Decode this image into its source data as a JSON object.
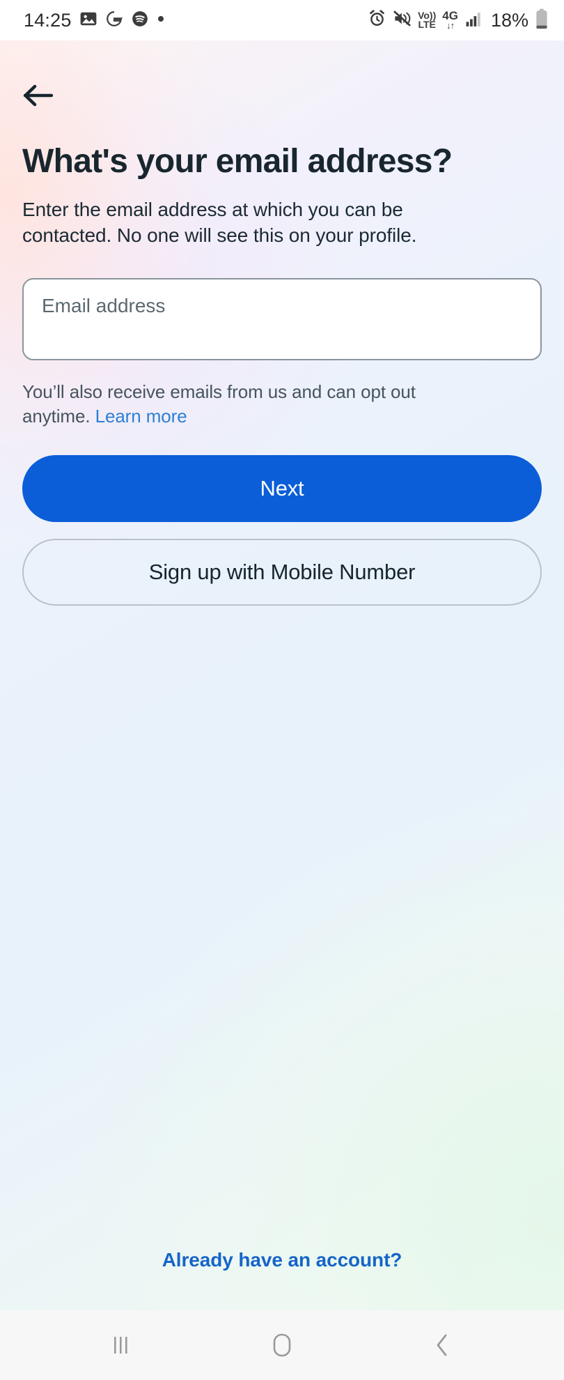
{
  "status_bar": {
    "clock": "14:25",
    "battery_percent": "18%",
    "network_generation": "4G",
    "volte_top": "Vo))",
    "volte_bottom": "LTE",
    "left_icons": [
      "gallery-icon",
      "google-icon",
      "spotify-icon",
      "dot-icon"
    ],
    "right_icons": [
      "alarm-icon",
      "mute-icon",
      "volte-icon",
      "signal-icon",
      "battery-icon"
    ]
  },
  "nav": {
    "back_icon": "back-arrow-icon"
  },
  "main": {
    "heading": "What's your email address?",
    "description": "Enter the email address at which you can be contacted. No one will see this on your profile.",
    "email_placeholder": "Email address",
    "email_value": "",
    "helper_text": "You’ll also receive emails from us and can opt out anytime. ",
    "helper_link": "Learn more",
    "primary_button": "Next",
    "secondary_button": "Sign up with Mobile Number",
    "bottom_link": "Already have an account?"
  },
  "system_nav": {
    "recents_label": "recents-icon",
    "home_label": "home-icon",
    "back_label": "back-icon"
  },
  "colors": {
    "primary_blue": "#0b5ed7",
    "link_blue": "#2d7fd3",
    "bottom_link_blue": "#1565c9",
    "heading_dark": "#19262e",
    "border_gray": "#8a949b"
  }
}
